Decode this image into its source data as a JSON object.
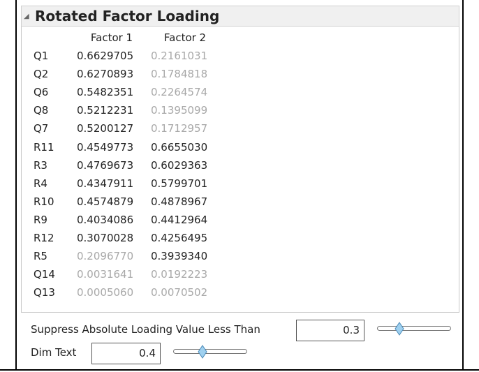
{
  "report": {
    "title": "Rotated Factor Loading",
    "columns": [
      "Factor 1",
      "Factor 2"
    ],
    "rows": [
      {
        "label": "Q1",
        "f1": "0.6629705",
        "f2": "0.2161031",
        "f1_dim": false,
        "f2_dim": true
      },
      {
        "label": "Q2",
        "f1": "0.6270893",
        "f2": "0.1784818",
        "f1_dim": false,
        "f2_dim": true
      },
      {
        "label": "Q6",
        "f1": "0.5482351",
        "f2": "0.2264574",
        "f1_dim": false,
        "f2_dim": true
      },
      {
        "label": "Q8",
        "f1": "0.5212231",
        "f2": "0.1395099",
        "f1_dim": false,
        "f2_dim": true
      },
      {
        "label": "Q7",
        "f1": "0.5200127",
        "f2": "0.1712957",
        "f1_dim": false,
        "f2_dim": true
      },
      {
        "label": "R11",
        "f1": "0.4549773",
        "f2": "0.6655030",
        "f1_dim": false,
        "f2_dim": false
      },
      {
        "label": "R3",
        "f1": "0.4769673",
        "f2": "0.6029363",
        "f1_dim": false,
        "f2_dim": false
      },
      {
        "label": "R4",
        "f1": "0.4347911",
        "f2": "0.5799701",
        "f1_dim": false,
        "f2_dim": false
      },
      {
        "label": "R10",
        "f1": "0.4574879",
        "f2": "0.4878967",
        "f1_dim": false,
        "f2_dim": false
      },
      {
        "label": "R9",
        "f1": "0.4034086",
        "f2": "0.4412964",
        "f1_dim": false,
        "f2_dim": false
      },
      {
        "label": "R12",
        "f1": "0.3070028",
        "f2": "0.4256495",
        "f1_dim": false,
        "f2_dim": false
      },
      {
        "label": "R5",
        "f1": "0.2096770",
        "f2": "0.3939340",
        "f1_dim": true,
        "f2_dim": false
      },
      {
        "label": "Q14",
        "f1": "0.0031641",
        "f2": "0.0192223",
        "f1_dim": true,
        "f2_dim": true
      },
      {
        "label": "Q13",
        "f1": "0.0005060",
        "f2": "0.0070502",
        "f1_dim": true,
        "f2_dim": true
      }
    ]
  },
  "controls": {
    "suppress_label": "Suppress Absolute Loading Value Less Than",
    "suppress_value": "0.3",
    "suppress_slider_fraction": 0.3,
    "dim_label": "Dim Text",
    "dim_value": "0.4",
    "dim_slider_fraction": 0.4
  },
  "colors": {
    "normal_text": "#222222",
    "dim_text": "#a8a8a8",
    "slider_thumb": "#9fd0ef"
  }
}
